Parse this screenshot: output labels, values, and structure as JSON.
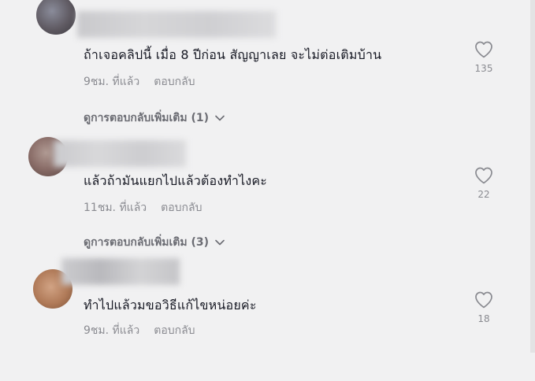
{
  "comments": [
    {
      "text": "ถ้าเจอคลิปนี้ เมื่อ 8 ปีก่อน สัญญาเลย จะไม่ต่อเติมบ้าน",
      "time": "9ชม. ที่แล้ว",
      "reply_label": "ตอบกลับ",
      "view_replies": "ดูการตอบกลับเพิ่มเติม (1)",
      "likes": "135"
    },
    {
      "text": "แล้วถ้ามันแยกไปแล้วต้องทำไงคะ",
      "time": "11ชม. ที่แล้ว",
      "reply_label": "ตอบกลับ",
      "view_replies": "ดูการตอบกลับเพิ่มเติม (3)",
      "likes": "22"
    },
    {
      "text": "ทำไปแล้วมขอวิธีแก้ไขหน่อยค่ะ",
      "time": "9ชม. ที่แล้ว",
      "reply_label": "ตอบกลับ",
      "likes": "18"
    }
  ],
  "icons": {
    "like": "heart-outline-icon",
    "expand": "chevron-down-icon"
  },
  "colors": {
    "background": "#f1f1f2",
    "text_primary": "#161823",
    "text_secondary": "#8a8b91",
    "view_replies": "#6b6c73"
  }
}
